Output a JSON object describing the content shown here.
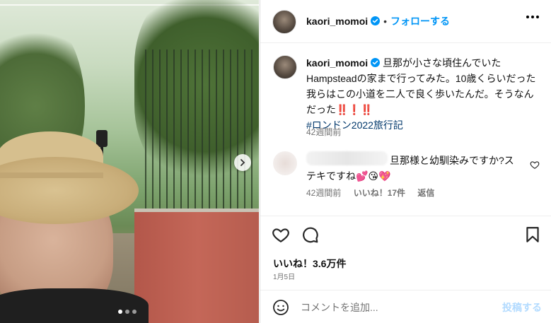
{
  "post": {
    "username": "kaori_momoi",
    "follow_label": "フォローする",
    "separator": "•"
  },
  "caption": {
    "username": "kaori_momoi",
    "text": "旦那が小さな頃住んでいたHampsteadの家まで行ってみた。10歳くらいだった我らはこの小道を二人で良く歩いたんだ。そうなんだった‼️❗‼️",
    "hashtag": "#ロンドン2022旅行記",
    "time": "42週間前"
  },
  "comment": {
    "text": "旦那様と幼馴染みですか?ステキですね💕😘💖",
    "time": "42週間前",
    "likes": "いいね！17件",
    "reply": "返信"
  },
  "footer": {
    "likes": "いいね！3.6万件",
    "date": "1月5日",
    "comment_placeholder": "コメントを追加...",
    "post_label": "投稿する"
  },
  "carousel": {
    "total": 3,
    "current": 1
  },
  "colors": {
    "accent": "#0095f6",
    "hashtag": "#00376b",
    "muted": "#737373",
    "post_disabled": "#b3dbff"
  },
  "icons": [
    "verified-badge-icon",
    "more-options-icon",
    "heart-icon",
    "comment-icon",
    "save-bookmark-icon",
    "emoji-icon",
    "chevron-right-icon"
  ]
}
